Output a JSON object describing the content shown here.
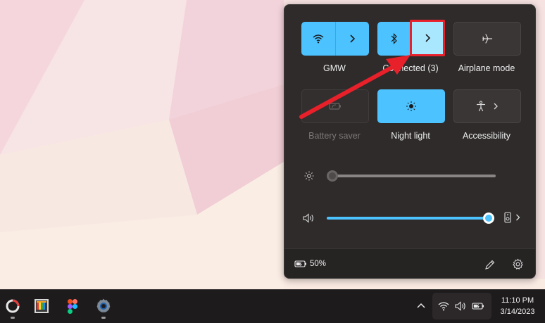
{
  "quick_settings": {
    "tiles": [
      {
        "label": "GMW",
        "state": "on",
        "icon": "wifi-icon",
        "has_chevron": true
      },
      {
        "label": "Connected (3)",
        "visible_label": "Connected (3)",
        "state": "on",
        "icon": "bluetooth-icon",
        "has_chevron": true
      },
      {
        "label": "Airplane mode",
        "state": "off",
        "icon": "airplane-icon",
        "has_chevron": false
      },
      {
        "label": "Battery saver",
        "state": "disabled",
        "icon": "battery-saver-icon",
        "has_chevron": false
      },
      {
        "label": "Night light",
        "state": "on",
        "icon": "night-light-icon",
        "has_chevron": false
      },
      {
        "label": "Accessibility",
        "state": "off",
        "icon": "accessibility-icon",
        "has_chevron": true
      }
    ],
    "brightness": {
      "icon": "sun-icon",
      "value": 0
    },
    "volume": {
      "icon": "speaker-icon",
      "value": 100,
      "output_icon": "speaker-device-icon"
    },
    "battery": {
      "percent_label": "50%",
      "icon": "battery-charging-icon"
    },
    "footer_icons": [
      "edit-pencil-icon",
      "settings-gear-icon"
    ]
  },
  "taskbar": {
    "apps": [
      {
        "name": "app-ring-icon",
        "running": true
      },
      {
        "name": "app-palette-icon",
        "running": false
      },
      {
        "name": "figma-icon",
        "running": false
      },
      {
        "name": "settings-app-icon",
        "running": true
      }
    ],
    "tray": {
      "icons": [
        "chevron-up-icon",
        "wifi-icon",
        "volume-icon",
        "battery-icon"
      ]
    },
    "clock": {
      "time": "11:10 PM",
      "date": "3/14/2023"
    }
  },
  "colors": {
    "accent": "#4cc2ff",
    "highlight": "#e8202a"
  }
}
